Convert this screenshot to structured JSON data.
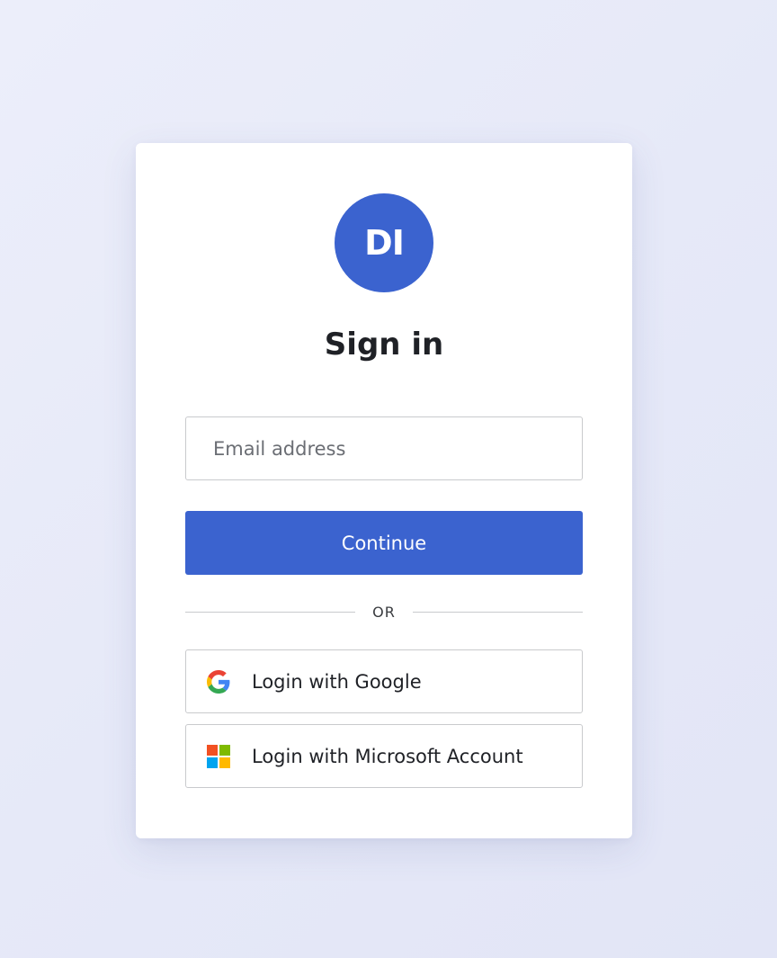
{
  "logo": {
    "initials": "DI",
    "color": "#3b63cf"
  },
  "header": {
    "title": "Sign in"
  },
  "form": {
    "email_placeholder": "Email address",
    "email_value": "",
    "continue_label": "Continue",
    "primary_color": "#3b63cf"
  },
  "divider": {
    "text": "OR"
  },
  "social": {
    "google": {
      "label": "Login with Google",
      "icon": "google-icon"
    },
    "microsoft": {
      "label": "Login with Microsoft Account",
      "icon": "microsoft-icon"
    }
  }
}
